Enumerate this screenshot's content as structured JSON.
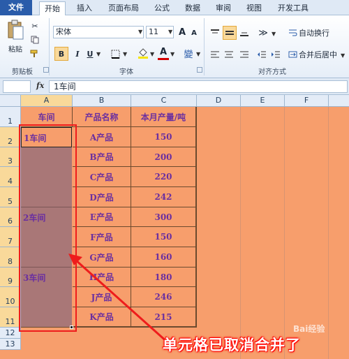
{
  "ribbon_tabs": [
    "文件",
    "开始",
    "插入",
    "页面布局",
    "公式",
    "数据",
    "审阅",
    "视图",
    "开发工具"
  ],
  "clipboard": {
    "paste_label": "粘贴",
    "group_label": "剪贴板"
  },
  "font": {
    "name": "宋体",
    "size": "11",
    "grow_label": "A",
    "shrink_label": "A",
    "bold": "B",
    "italic": "I",
    "underline": "U",
    "font_color_label": "A",
    "phonetic_label": "變",
    "group_label": "字体"
  },
  "alignment": {
    "wrap_text": "自动换行",
    "merge_center": "合并后居中",
    "group_label": "对齐方式"
  },
  "formula_bar": {
    "fx": "fx",
    "content": "1车间"
  },
  "columns": [
    "A",
    "B",
    "C",
    "D",
    "E",
    "F"
  ],
  "rows": [
    "1",
    "2",
    "3",
    "4",
    "5",
    "6",
    "7",
    "8",
    "9",
    "10",
    "11",
    "12",
    "13"
  ],
  "table": {
    "headers": [
      "车间",
      "产品名称",
      "本月产量/吨"
    ],
    "workshops": [
      "1车间",
      "2车间",
      "3车间"
    ],
    "products": [
      "A产品",
      "B产品",
      "C产品",
      "D产品",
      "E产品",
      "F产品",
      "G产品",
      "H产品",
      "J产品",
      "K产品"
    ],
    "outputs": [
      "150",
      "200",
      "220",
      "242",
      "300",
      "150",
      "160",
      "180",
      "246",
      "215"
    ]
  },
  "annotation": "单元格已取消合并了",
  "watermark": "Bai经验",
  "colors": {
    "sheet_bg": "#f79e6c",
    "unmerged_cells": "#a97777",
    "highlight_box": "#ee1c1c",
    "text": "#6a2fa0"
  }
}
